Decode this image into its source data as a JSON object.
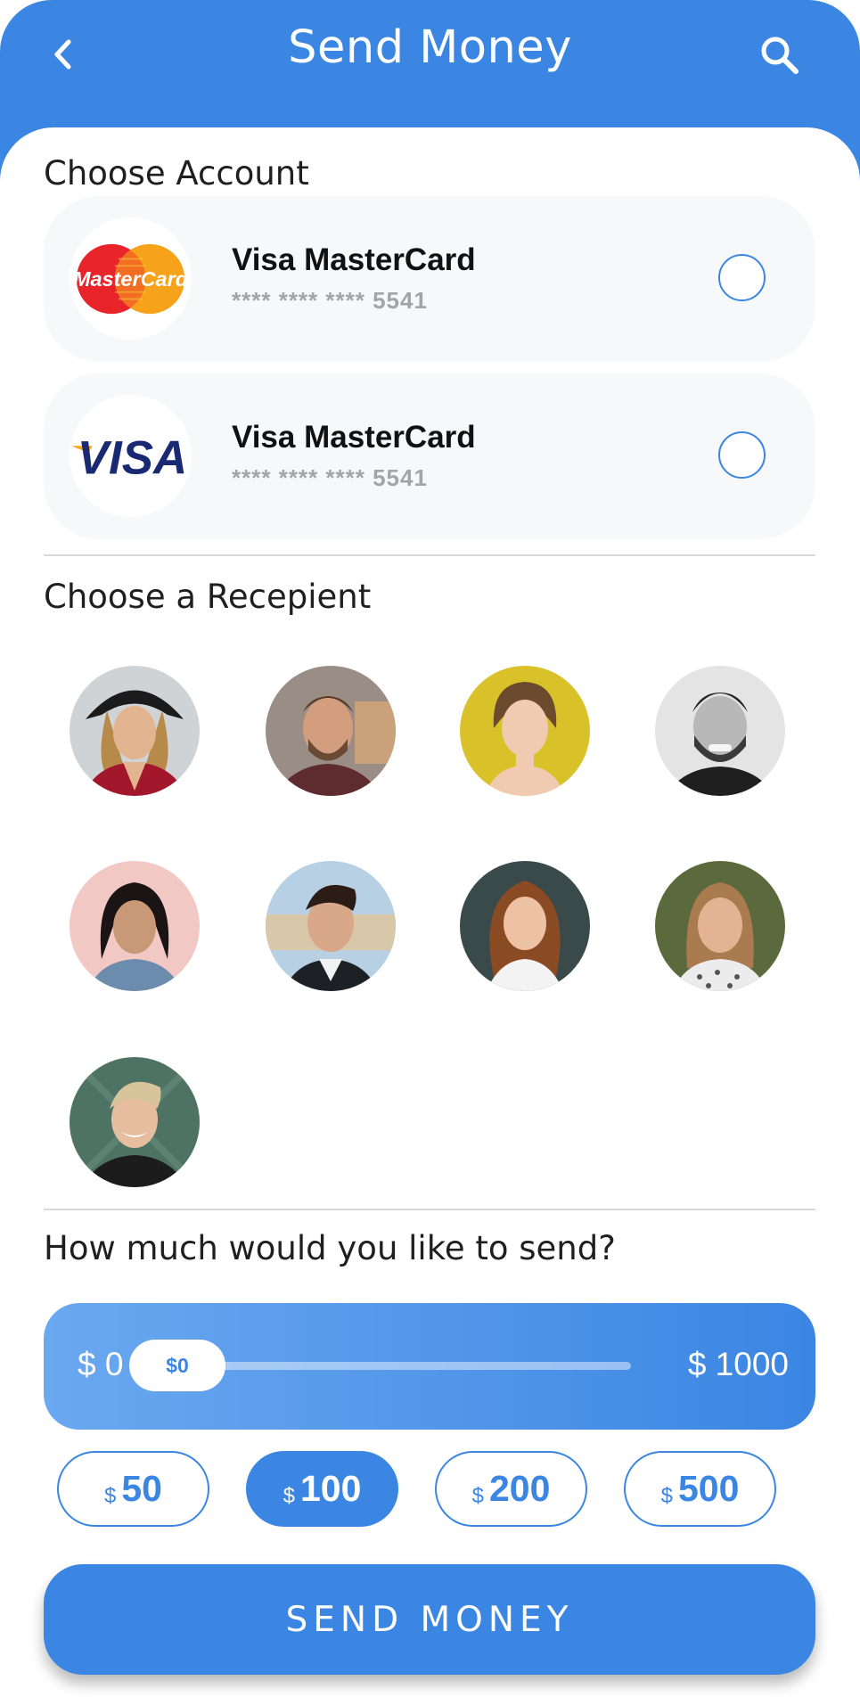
{
  "header": {
    "title": "Send Money",
    "back_icon": "chevron-left-icon",
    "search_icon": "search-icon",
    "color": "#3b86e3"
  },
  "accounts": {
    "title": "Choose Account",
    "items": [
      {
        "logo": "mastercard-logo",
        "logo_text": "MasterCard",
        "name": "Visa MasterCard",
        "number": "**** **** **** 5541"
      },
      {
        "logo": "visa-logo",
        "logo_text": "VISA",
        "name": "Visa MasterCard",
        "number": "**** **** **** 5541"
      }
    ]
  },
  "recipients": {
    "title": "Choose a Recepient",
    "count": 9
  },
  "amount": {
    "title": "How much would you like to send?",
    "slider": {
      "min_label": "$ 0",
      "max_label": "$ 1000",
      "value_label": "$0",
      "value": 0
    },
    "presets": [
      {
        "currency": "$",
        "amount": "50",
        "selected": false
      },
      {
        "currency": "$",
        "amount": "100",
        "selected": true
      },
      {
        "currency": "$",
        "amount": "200",
        "selected": false
      },
      {
        "currency": "$",
        "amount": "500",
        "selected": false
      }
    ]
  },
  "send_button": "SEND MONEY"
}
